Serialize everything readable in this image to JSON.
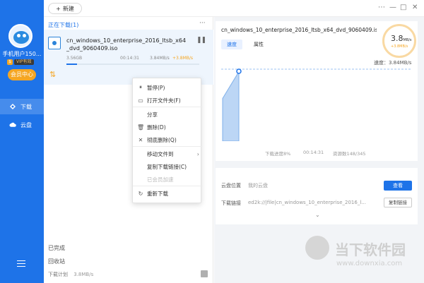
{
  "colors": {
    "accent": "#1e73e8",
    "orange": "#f5a623",
    "sidebar": "#1e73e8"
  },
  "toolbar": {
    "new_label": "新建",
    "new_icon": "plus-icon"
  },
  "window_controls": {
    "more": "⋯",
    "minimize": "—",
    "maximize": "□",
    "close": "✕"
  },
  "sidebar": {
    "username": "手机用户150...",
    "vip": "VIP有效",
    "member_center": "会员中心",
    "items": [
      {
        "label": "下载",
        "icon": "download-icon"
      },
      {
        "label": "云盘",
        "icon": "cloud-icon"
      }
    ]
  },
  "middle": {
    "section_title": "正在下载(1)",
    "more": "···",
    "item": {
      "file_name": "cn_windows_10_enterprise_2016_ltsb_x64_dvd_9060409.iso",
      "size": "3.56GB",
      "time": "00:14:31",
      "speed": "3.84MB/s",
      "boost": "+3.8MB/s",
      "progress": 0.08
    },
    "completed": "已完成",
    "recycle": "回收站",
    "plan_label": "下载计划",
    "plan_speed": "3.8MB/s"
  },
  "context_menu": [
    {
      "label": "暂停(P)",
      "icon": "pause-icon",
      "disabled": false
    },
    {
      "label": "打开文件夹(F)",
      "icon": "folder-icon",
      "disabled": false
    },
    {
      "label": "分享",
      "icon": "",
      "disabled": false
    },
    {
      "label": "删除(D)",
      "icon": "trash-icon",
      "disabled": false
    },
    {
      "label": "彻底删除(Q)",
      "icon": "x-icon",
      "disabled": false
    },
    {
      "label": "移动文件到",
      "icon": "",
      "disabled": false,
      "submenu": true
    },
    {
      "label": "复制下载链接(C)",
      "icon": "",
      "disabled": false
    },
    {
      "label": "已会员加速",
      "icon": "",
      "disabled": true
    },
    {
      "label": "重新下载",
      "icon": "refresh-icon",
      "disabled": false
    }
  ],
  "detail": {
    "file_name": "cn_windows_10_enterprise_2016_ltsb_x64_dvd_9060409.iso",
    "speed_value": "3.8",
    "speed_unit": "MB/s",
    "speed_boost": "+3.8MB/s",
    "tabs": [
      "速度",
      "属性"
    ],
    "speed_label": "速度：3.84MB/s",
    "footer_progress": "下载进度8%",
    "footer_time": "00:14:31",
    "footer_resources": "资源数148/345"
  },
  "chart_data": {
    "type": "area",
    "title": "",
    "xlabel": "",
    "ylabel": "",
    "values": [
      0.55,
      0.85,
      0.9,
      0.9,
      0.9,
      0.9,
      0.9,
      0.9,
      0.9,
      0.9,
      0.9
    ],
    "grid": false
  },
  "cloud": {
    "location_label": "云盘位置",
    "location_value": "我的云盘",
    "open_button": "查看",
    "link_label": "下载链接",
    "link_value": "ed2k://|file|cn_windows_10_enterprise_2016_l...",
    "copy_button": "复制链接",
    "expand_icon": "chevron-down-icon"
  },
  "watermark": {
    "text": "当下软件园",
    "url": "www.downxia.com"
  }
}
